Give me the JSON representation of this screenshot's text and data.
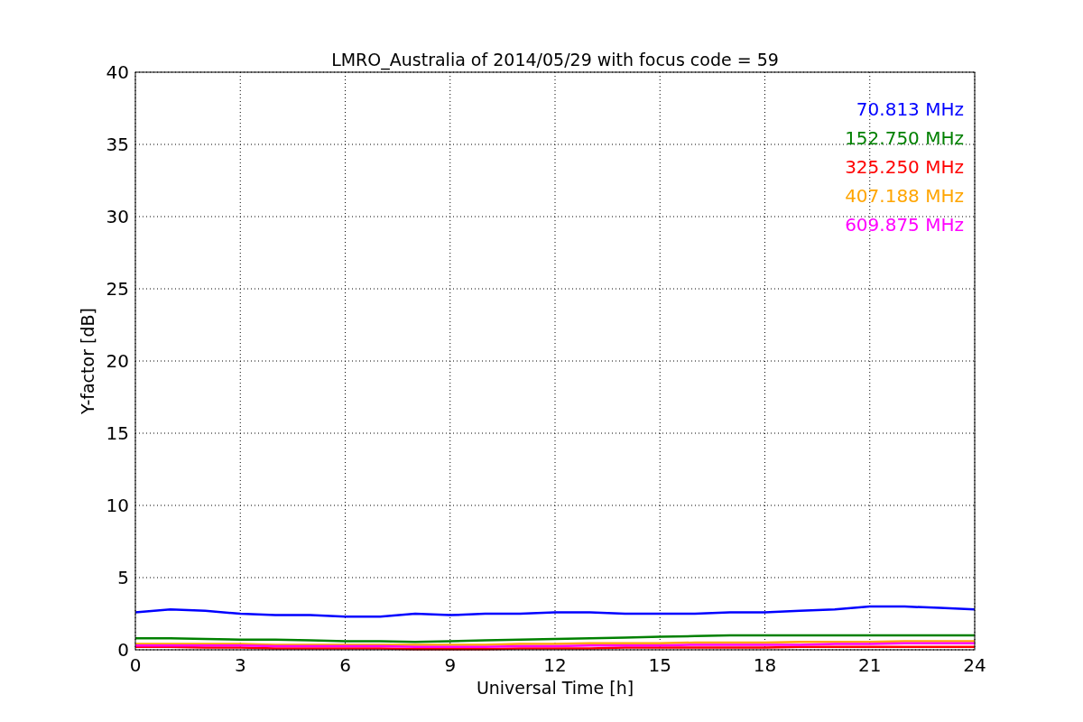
{
  "figure": {
    "chart_data": {
      "type": "line",
      "title": "LMRO_Australia of 2014/05/29 with focus code = 59",
      "xlabel": "Universal Time [h]",
      "ylabel": "Y-factor [dB]",
      "x": [
        0,
        1,
        2,
        3,
        4,
        5,
        6,
        7,
        8,
        9,
        10,
        11,
        12,
        13,
        14,
        15,
        16,
        17,
        18,
        19,
        20,
        21,
        22,
        23,
        24
      ],
      "series": [
        {
          "name": "70.813 MHz",
          "color": "#0000ff",
          "values": [
            2.6,
            2.8,
            2.7,
            2.5,
            2.4,
            2.4,
            2.3,
            2.3,
            2.5,
            2.4,
            2.5,
            2.5,
            2.6,
            2.6,
            2.5,
            2.5,
            2.5,
            2.6,
            2.6,
            2.7,
            2.8,
            3.0,
            3.0,
            2.9,
            2.8
          ]
        },
        {
          "name": "152.750 MHz",
          "color": "#008000",
          "values": [
            0.8,
            0.8,
            0.75,
            0.7,
            0.7,
            0.65,
            0.6,
            0.6,
            0.55,
            0.6,
            0.65,
            0.7,
            0.75,
            0.8,
            0.85,
            0.9,
            0.95,
            1.0,
            1.0,
            1.0,
            1.0,
            1.0,
            1.0,
            1.0,
            1.0
          ]
        },
        {
          "name": "325.250 MHz",
          "color": "#ff0000",
          "values": [
            0.2,
            0.2,
            0.15,
            0.15,
            0.1,
            0.1,
            0.1,
            0.1,
            0.05,
            0.05,
            0.05,
            0.1,
            0.1,
            0.1,
            0.15,
            0.15,
            0.15,
            0.15,
            0.15,
            0.2,
            0.2,
            0.2,
            0.2,
            0.2,
            0.2
          ]
        },
        {
          "name": "407.188 MHz",
          "color": "#ffa500",
          "values": [
            0.4,
            0.4,
            0.4,
            0.4,
            0.35,
            0.35,
            0.35,
            0.35,
            0.35,
            0.35,
            0.35,
            0.4,
            0.4,
            0.45,
            0.45,
            0.45,
            0.5,
            0.5,
            0.5,
            0.55,
            0.55,
            0.55,
            0.6,
            0.6,
            0.6
          ]
        },
        {
          "name": "609.875 MHz",
          "color": "#ff00ff",
          "values": [
            0.3,
            0.3,
            0.3,
            0.3,
            0.25,
            0.25,
            0.25,
            0.25,
            0.2,
            0.2,
            0.2,
            0.25,
            0.25,
            0.3,
            0.3,
            0.3,
            0.35,
            0.35,
            0.35,
            0.35,
            0.4,
            0.4,
            0.45,
            0.45,
            0.45
          ]
        }
      ],
      "grid": true,
      "xlim": [
        0,
        24
      ],
      "ylim": [
        0,
        40
      ],
      "xticks": [
        0,
        3,
        6,
        9,
        12,
        15,
        18,
        21,
        24
      ],
      "yticks": [
        0,
        5,
        10,
        15,
        20,
        25,
        30,
        35,
        40
      ]
    }
  }
}
